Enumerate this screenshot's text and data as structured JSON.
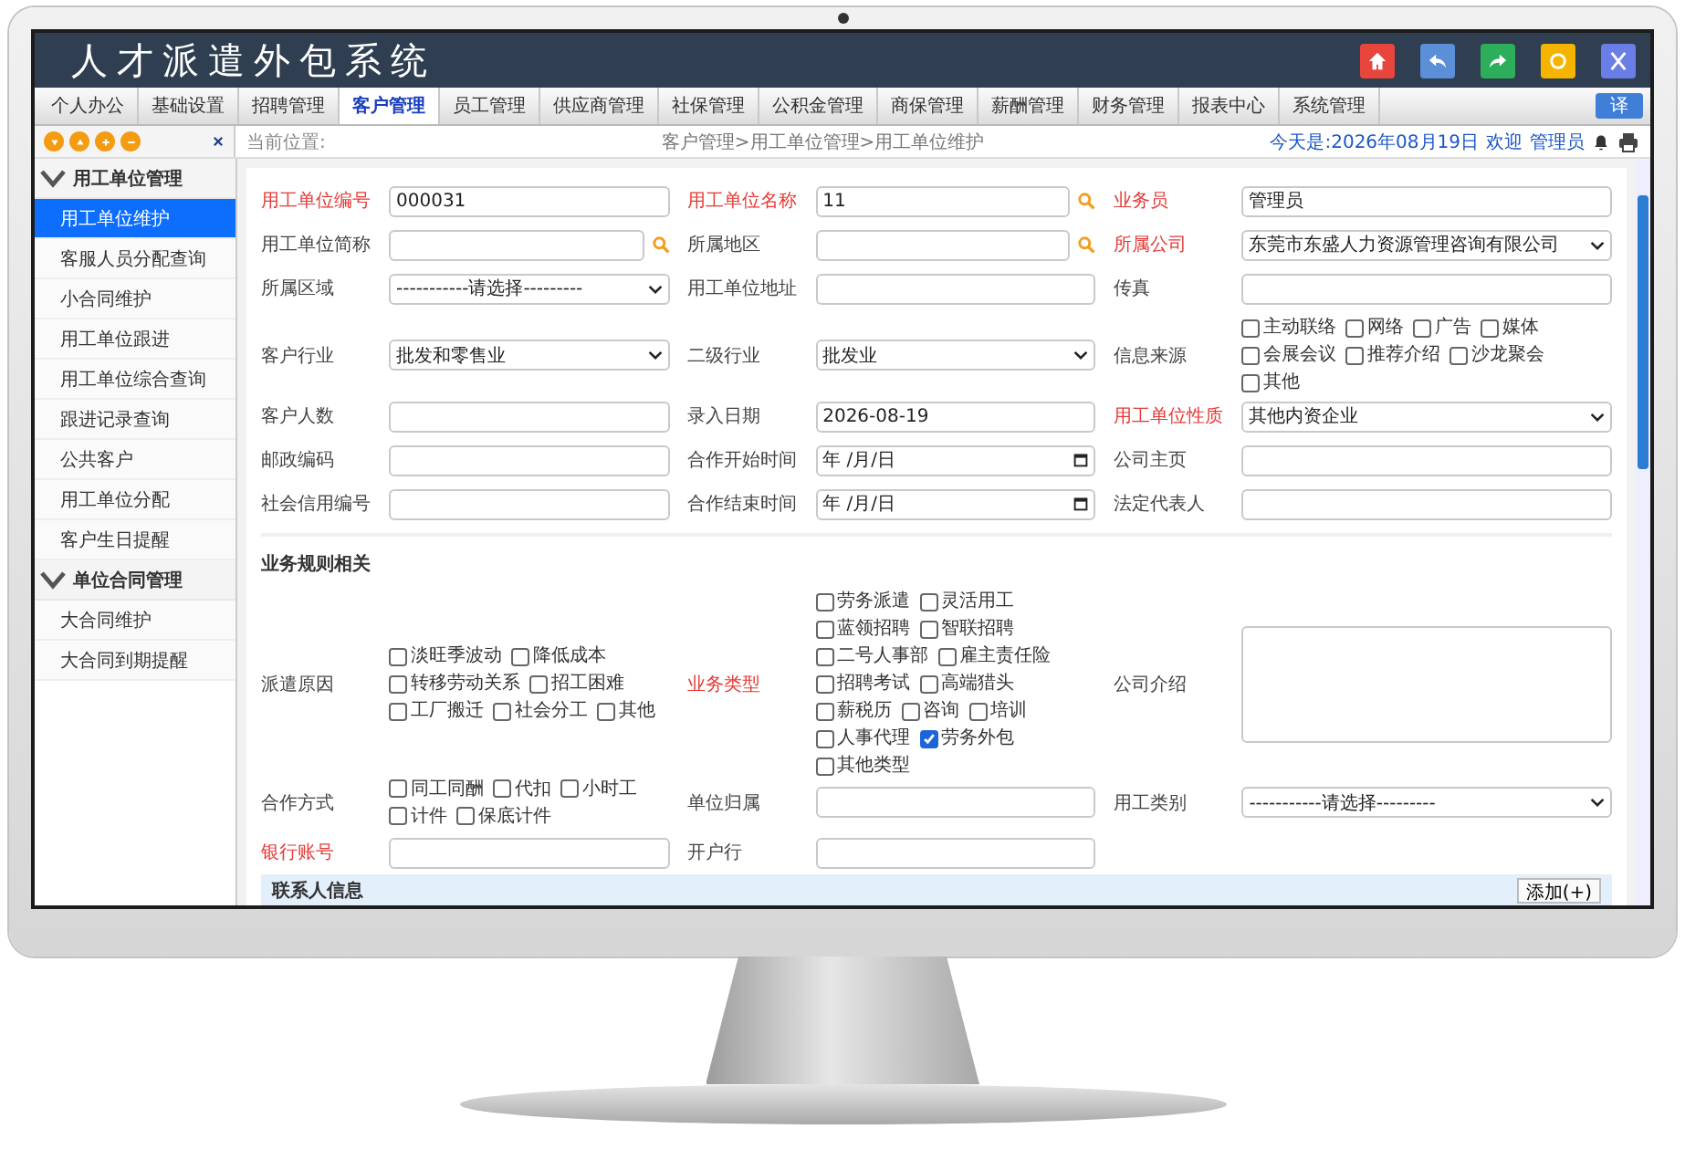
{
  "header": {
    "title": "人才派遣外包系统"
  },
  "tabs": [
    {
      "label": "个人办公",
      "selected": false
    },
    {
      "label": "基础设置",
      "selected": false
    },
    {
      "label": "招聘管理",
      "selected": false
    },
    {
      "label": "客户管理",
      "selected": true
    },
    {
      "label": "员工管理",
      "selected": false
    },
    {
      "label": "供应商管理",
      "selected": false
    },
    {
      "label": "社保管理",
      "selected": false
    },
    {
      "label": "公积金管理",
      "selected": false
    },
    {
      "label": "商保管理",
      "selected": false
    },
    {
      "label": "薪酬管理",
      "selected": false
    },
    {
      "label": "财务管理",
      "selected": false
    },
    {
      "label": "报表中心",
      "selected": false
    },
    {
      "label": "系统管理",
      "selected": false
    }
  ],
  "translate_button": "译",
  "location": {
    "label": "当前位置:",
    "path": "客户管理>用工单位管理>用工单位维护"
  },
  "status": {
    "date": "今天是:2026年08月19日",
    "welcome": "欢迎",
    "user": "管理员"
  },
  "sidebar": {
    "groups": [
      {
        "title": "用工单位管理",
        "expanded": true,
        "items": [
          {
            "label": "用工单位维护",
            "selected": true
          },
          {
            "label": "客服人员分配查询",
            "selected": false
          },
          {
            "label": "小合同维护",
            "selected": false
          },
          {
            "label": "用工单位跟进",
            "selected": false
          },
          {
            "label": "用工单位综合查询",
            "selected": false
          },
          {
            "label": "跟进记录查询",
            "selected": false
          },
          {
            "label": "公共客户",
            "selected": false
          },
          {
            "label": "用工单位分配",
            "selected": false
          },
          {
            "label": "客户生日提醒",
            "selected": false
          }
        ]
      },
      {
        "title": "单位合同管理",
        "expanded": true,
        "items": [
          {
            "label": "大合同维护",
            "selected": false
          },
          {
            "label": "大合同到期提醒",
            "selected": false
          }
        ]
      }
    ]
  },
  "form": {
    "top_rows": [
      [
        {
          "label": "用工单位编号",
          "kind": "text",
          "required": true,
          "value": "000031"
        },
        {
          "label": "用工单位名称",
          "kind": "text",
          "required": true,
          "value": "11",
          "search": true
        },
        {
          "label": "业务员",
          "kind": "text",
          "required": true,
          "value": "管理员"
        }
      ],
      [
        {
          "label": "用工单位简称",
          "kind": "text",
          "required": false,
          "search": true
        },
        {
          "label": "所属地区",
          "kind": "text",
          "required": false,
          "search": true
        },
        {
          "label": "所属公司",
          "kind": "select",
          "required": true,
          "value": "东莞市东盛人力资源管理咨询有限公司"
        }
      ],
      [
        {
          "label": "所属区域",
          "kind": "select",
          "required": false,
          "value": "-----------请选择---------"
        },
        {
          "label": "用工单位地址",
          "kind": "text",
          "required": false
        },
        {
          "label": "传真",
          "kind": "text",
          "required": false
        }
      ],
      [
        {
          "label": "客户行业",
          "kind": "select",
          "required": false,
          "value": "批发和零售业"
        },
        {
          "label": "二级行业",
          "kind": "select",
          "required": false,
          "value": "批发业"
        },
        {
          "label": "信息来源",
          "kind": "checks",
          "required": false,
          "options": [
            {
              "label": "主动联络",
              "checked": false
            },
            {
              "label": "网络",
              "checked": false
            },
            {
              "label": "广告",
              "checked": false
            },
            {
              "label": "媒体",
              "checked": false
            },
            {
              "label": "会展会议",
              "checked": false
            },
            {
              "label": "推荐介绍",
              "checked": false
            },
            {
              "label": "沙龙聚会",
              "checked": false
            },
            {
              "label": "其他",
              "checked": false
            }
          ]
        }
      ],
      [
        {
          "label": "客户人数",
          "kind": "text",
          "required": false
        },
        {
          "label": "录入日期",
          "kind": "text",
          "required": false,
          "value": "2026-08-19"
        },
        {
          "label": "用工单位性质",
          "kind": "select",
          "required": true,
          "value": "其他内资企业"
        }
      ],
      [
        {
          "label": "邮政编码",
          "kind": "text",
          "required": false
        },
        {
          "label": "合作开始时间",
          "kind": "date",
          "required": false,
          "placeholder": "年 /月/日"
        },
        {
          "label": "公司主页",
          "kind": "text",
          "required": false
        }
      ],
      [
        {
          "label": "社会信用编号",
          "kind": "text",
          "required": false
        },
        {
          "label": "合作结束时间",
          "kind": "date",
          "required": false,
          "placeholder": "年 /月/日"
        },
        {
          "label": "法定代表人",
          "kind": "text",
          "required": false
        }
      ]
    ],
    "section_title": "业务规则相关",
    "rule_rows": [
      [
        {
          "label": "派遣原因",
          "kind": "checks",
          "required": false,
          "options": [
            {
              "label": "淡旺季波动",
              "checked": false
            },
            {
              "label": "降低成本",
              "checked": false
            },
            {
              "label": "转移劳动关系",
              "checked": false
            },
            {
              "label": "招工困难",
              "checked": false
            },
            {
              "label": "工厂搬迁",
              "checked": false
            },
            {
              "label": "社会分工",
              "checked": false
            },
            {
              "label": "其他",
              "checked": false
            }
          ]
        },
        {
          "label": "业务类型",
          "kind": "checks",
          "required": true,
          "options": [
            {
              "label": "劳务派遣",
              "checked": false
            },
            {
              "label": "灵活用工",
              "checked": false
            },
            {
              "label": "蓝领招聘",
              "checked": false
            },
            {
              "label": "智联招聘",
              "checked": false
            },
            {
              "label": "二号人事部",
              "checked": false
            },
            {
              "label": "雇主责任险",
              "checked": false
            },
            {
              "label": "招聘考试",
              "checked": false
            },
            {
              "label": "高端猎头",
              "checked": false
            },
            {
              "label": "薪税历",
              "checked": false
            },
            {
              "label": "咨询",
              "checked": false
            },
            {
              "label": "培训",
              "checked": false
            },
            {
              "label": "人事代理",
              "checked": false
            },
            {
              "label": "劳务外包",
              "checked": true
            },
            {
              "label": "其他类型",
              "checked": false
            }
          ]
        },
        {
          "label": "公司介绍",
          "kind": "textarea",
          "required": false
        }
      ],
      [
        {
          "label": "合作方式",
          "kind": "checks",
          "required": false,
          "options": [
            {
              "label": "同工同酬",
              "checked": false
            },
            {
              "label": "代扣",
              "checked": false
            },
            {
              "label": "小时工",
              "checked": false
            },
            {
              "label": "计件",
              "checked": false
            },
            {
              "label": "保底计件",
              "checked": false
            }
          ]
        },
        {
          "label": "单位归属",
          "kind": "text",
          "required": false
        },
        {
          "label": "用工类别",
          "kind": "select",
          "required": false,
          "value": "-----------请选择---------"
        }
      ],
      [
        {
          "label": "银行账号",
          "kind": "text",
          "required": true
        },
        {
          "label": "开户行",
          "kind": "text",
          "required": false
        }
      ]
    ]
  },
  "contacts": {
    "title": "联系人信息",
    "add_button": "添加(+)"
  }
}
